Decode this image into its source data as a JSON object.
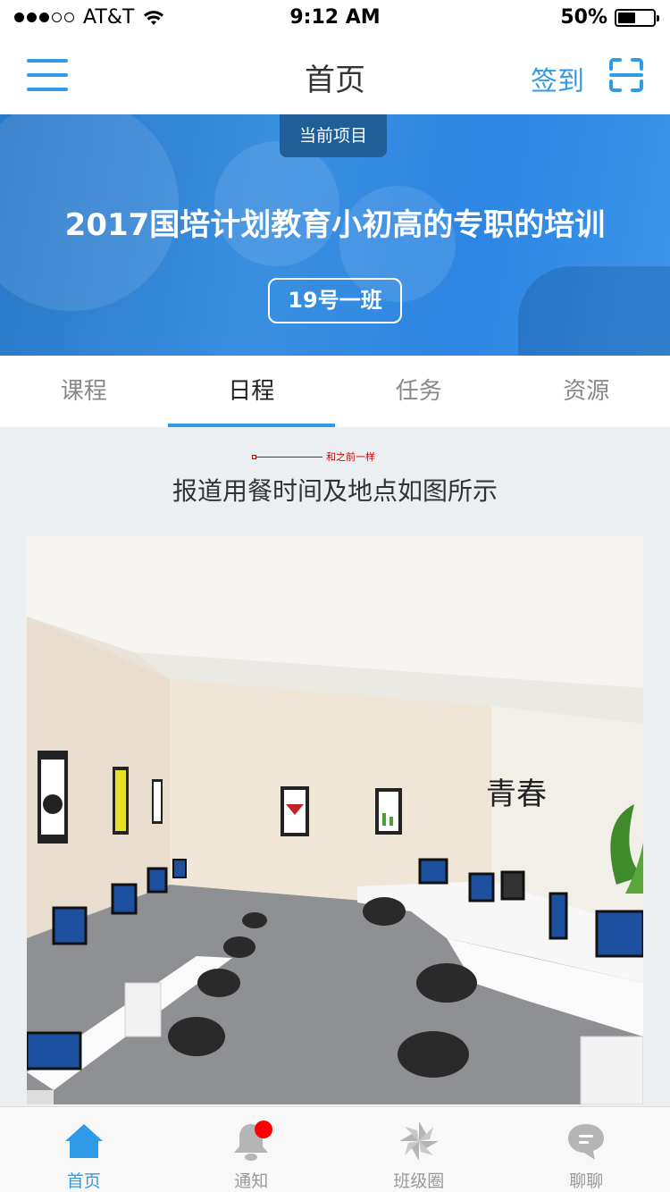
{
  "status_bar": {
    "carrier": "AT&T",
    "time": "9:12 AM",
    "battery": "50%",
    "battery_level": 0.5
  },
  "nav": {
    "title": "首页",
    "checkin_label": "签到"
  },
  "banner": {
    "tag": "当前项目",
    "title": "2017国培计划教育小初高的专职的培训",
    "class_name": "19号一班"
  },
  "tabs": [
    {
      "label": "课程"
    },
    {
      "label": "日程"
    },
    {
      "label": "任务"
    },
    {
      "label": "资源"
    }
  ],
  "content": {
    "annotation": "和之前一样",
    "section_title": "报道用餐时间及地点如图所示"
  },
  "tabbar": [
    {
      "label": "首页",
      "icon": "home-icon"
    },
    {
      "label": "通知",
      "icon": "bell-icon"
    },
    {
      "label": "班级圈",
      "icon": "pinwheel-icon"
    },
    {
      "label": "聊聊",
      "icon": "chat-icon"
    }
  ],
  "colors": {
    "accent": "#2f9be8",
    "badge": "#ff0000"
  }
}
